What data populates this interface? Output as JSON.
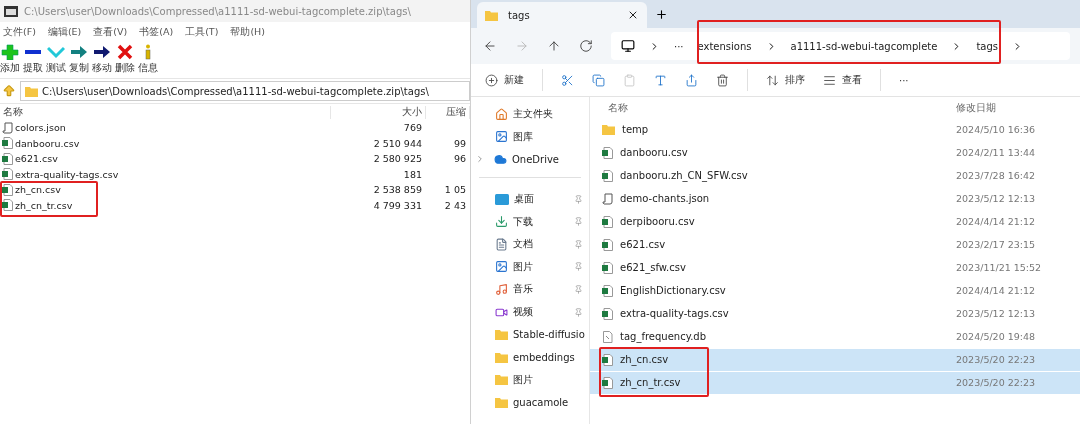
{
  "archive_window": {
    "title": "C:\\Users\\user\\Downloads\\Compressed\\a1111-sd-webui-tagcomplete.zip\\tags\\",
    "menu": [
      "文件(F)",
      "编辑(E)",
      "查看(V)",
      "书签(A)",
      "工具(T)",
      "帮助(H)"
    ],
    "toolbar": [
      {
        "kind": "add",
        "label": "添加"
      },
      {
        "kind": "extract",
        "label": "提取"
      },
      {
        "kind": "test",
        "label": "测试"
      },
      {
        "kind": "copy",
        "label": "复制"
      },
      {
        "kind": "move",
        "label": "移动"
      },
      {
        "kind": "delete",
        "label": "删除"
      },
      {
        "kind": "info",
        "label": "信息"
      }
    ],
    "path": "C:\\Users\\user\\Downloads\\Compressed\\a1111-sd-webui-tagcomplete.zip\\tags\\",
    "columns": [
      "名称",
      "大小",
      "压缩"
    ],
    "rows": [
      {
        "kind": "json",
        "name": "colors.json",
        "size": "769"
      },
      {
        "kind": "csv",
        "name": "danbooru.csv",
        "size": "2 510 944",
        "packed": "99"
      },
      {
        "kind": "csv",
        "name": "e621.csv",
        "size": "2 580 925",
        "packed": "96"
      },
      {
        "kind": "csv",
        "name": "extra-quality-tags.csv",
        "size": "181"
      },
      {
        "kind": "csv",
        "name": "zh_cn.csv",
        "size": "2 538 859",
        "packed": "1 05"
      },
      {
        "kind": "csv",
        "name": "zh_cn_tr.csv",
        "size": "4 799 331",
        "packed": "2 43"
      }
    ]
  },
  "explorer_window": {
    "tab": {
      "title": "tags"
    },
    "nav": [
      {
        "kind": "back",
        "disabled": false
      },
      {
        "kind": "forward",
        "disabled": true
      },
      {
        "kind": "up",
        "disabled": false
      },
      {
        "kind": "refresh",
        "disabled": false
      }
    ],
    "breadcrumb": {
      "more": "···",
      "parts": [
        "extensions",
        "a1111-sd-webui-tagcomplete",
        "tags"
      ]
    },
    "commands": [
      {
        "kind": "new",
        "label": "新建",
        "disabled": false
      },
      {
        "kind": "cut",
        "disabled": false
      },
      {
        "kind": "copy",
        "disabled": false
      },
      {
        "kind": "paste",
        "disabled": true
      },
      {
        "kind": "rename",
        "disabled": false
      },
      {
        "kind": "share",
        "disabled": false
      },
      {
        "kind": "delete",
        "disabled": false
      },
      {
        "kind": "sort",
        "label": "排序",
        "disabled": false
      },
      {
        "kind": "view",
        "label": "查看",
        "disabled": false
      },
      {
        "kind": "more",
        "label": "···",
        "disabled": false
      }
    ],
    "sidebar": {
      "places": [
        {
          "kind": "home",
          "label": "主文件夹",
          "expandable": false
        },
        {
          "kind": "gallery",
          "label": "图库",
          "expandable": false
        },
        {
          "kind": "cloud",
          "label": "OneDrive",
          "expandable": true
        }
      ],
      "quick_access": [
        {
          "kind": "desktop",
          "label": "桌面",
          "pinned": true
        },
        {
          "kind": "download",
          "label": "下载",
          "pinned": true
        },
        {
          "kind": "document",
          "label": "文档",
          "pinned": true
        },
        {
          "kind": "pictures",
          "label": "图片",
          "pinned": true
        },
        {
          "kind": "music",
          "label": "音乐",
          "pinned": true
        },
        {
          "kind": "video",
          "label": "视频",
          "pinned": true
        },
        {
          "kind": "folder",
          "label": "Stable-diffusio",
          "pinned": false
        },
        {
          "kind": "folder",
          "label": "embeddings",
          "pinned": false
        },
        {
          "kind": "folder",
          "label": "图片",
          "pinned": false
        },
        {
          "kind": "folder",
          "label": "guacamole",
          "pinned": false
        }
      ]
    },
    "columns": [
      "名称",
      "修改日期"
    ],
    "files": [
      {
        "kind": "folder",
        "name": "temp",
        "modified": "2024/5/10 16:36",
        "selected": false
      },
      {
        "kind": "csv",
        "name": "danbooru.csv",
        "modified": "2024/2/11 13:44",
        "selected": false
      },
      {
        "kind": "csv",
        "name": "danbooru.zh_CN_SFW.csv",
        "modified": "2023/7/28 16:42",
        "selected": false
      },
      {
        "kind": "json",
        "name": "demo-chants.json",
        "modified": "2023/5/12 12:13",
        "selected": false
      },
      {
        "kind": "csv",
        "name": "derpibooru.csv",
        "modified": "2024/4/14 21:12",
        "selected": false
      },
      {
        "kind": "csv",
        "name": "e621.csv",
        "modified": "2023/2/17 23:15",
        "selected": false
      },
      {
        "kind": "csv",
        "name": "e621_sfw.csv",
        "modified": "2023/11/21 15:52",
        "selected": false
      },
      {
        "kind": "csv",
        "name": "EnglishDictionary.csv",
        "modified": "2024/4/14 21:12",
        "selected": false
      },
      {
        "kind": "csv",
        "name": "extra-quality-tags.csv",
        "modified": "2023/5/12 12:13",
        "selected": false
      },
      {
        "kind": "db",
        "name": "tag_frequency.db",
        "modified": "2024/5/20 19:48",
        "selected": false
      },
      {
        "kind": "csv",
        "name": "zh_cn.csv",
        "modified": "2023/5/20 22:23",
        "selected": true
      },
      {
        "kind": "csv",
        "name": "zh_cn_tr.csv",
        "modified": "2023/5/20 22:23",
        "selected": true
      }
    ]
  }
}
